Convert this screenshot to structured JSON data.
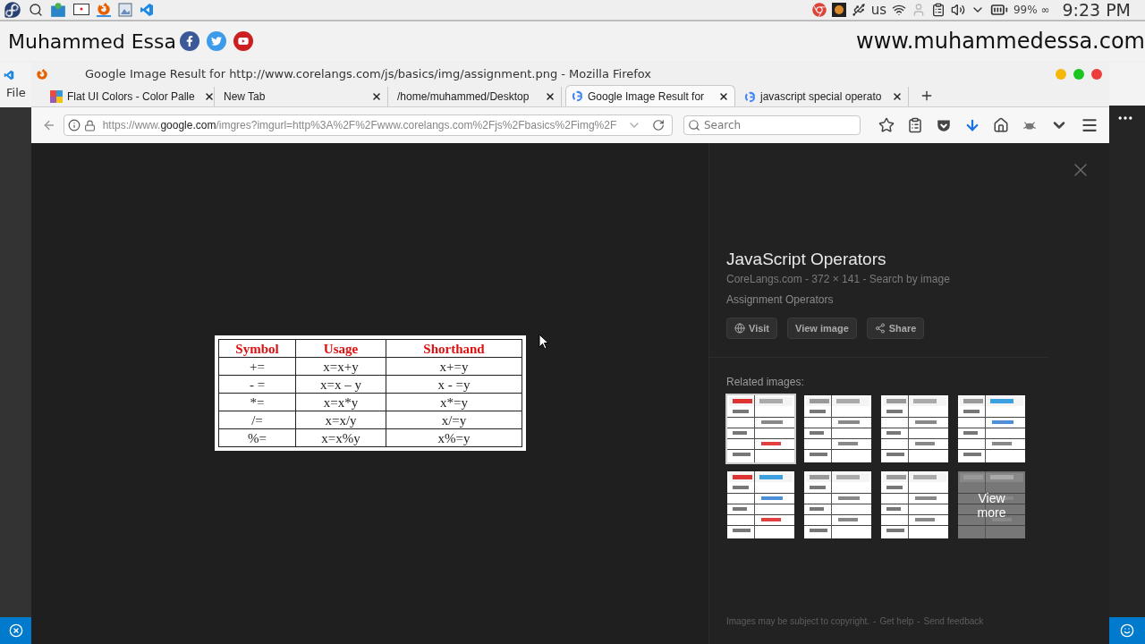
{
  "taskbar": {
    "keyboard_layout": "us",
    "battery": "99% ∞",
    "clock": "9:23 PM"
  },
  "banner": {
    "name": "Muhammed Essa",
    "website": "www.muhammedessa.com"
  },
  "editor": {
    "menu": "File"
  },
  "browser": {
    "title": "Google Image Result for http://www.corelangs.com/js/basics/img/assignment.png - Mozilla Firefox",
    "tabs": [
      {
        "label": "Flat UI Colors - Color Palle",
        "selected": false
      },
      {
        "label": "New Tab",
        "selected": false
      },
      {
        "label": "/home/muhammed/Desktop",
        "selected": false
      },
      {
        "label": "Google Image Result for",
        "selected": true
      },
      {
        "label": "javascript special operato",
        "selected": false
      }
    ],
    "url": {
      "scheme": "https://www.",
      "domain": "google.com",
      "path": "/imgres?imgurl=http%3A%2F%2Fwww.corelangs.com%2Fjs%2Fbasics%2Fimg%2F"
    },
    "search": {
      "placeholder": "Search"
    }
  },
  "image_table": {
    "columns": [
      "Symbol",
      "Usage",
      "Shorthand"
    ],
    "rows": [
      [
        "+=",
        "x=x+y",
        "x+=y"
      ],
      [
        "- =",
        "x=x – y",
        "x - =y"
      ],
      [
        "*=",
        "x=x*y",
        "x*=y"
      ],
      [
        "/=",
        "x=x/y",
        "x/=y"
      ],
      [
        "%=",
        "x=x%y",
        "x%=y"
      ]
    ]
  },
  "details": {
    "title": "JavaScript Operators",
    "meta": "CoreLangs.com - 372 × 141 - Search by image",
    "caption": "Assignment Operators",
    "buttons": [
      {
        "label": "Visit"
      },
      {
        "label": "View image"
      },
      {
        "label": "Share"
      }
    ],
    "related_label": "Related images:",
    "related": [
      {
        "kind": "picture",
        "selected": true
      },
      {
        "kind": "picture",
        "selected": false
      },
      {
        "kind": "picture",
        "selected": false
      },
      {
        "kind": "picture",
        "selected": false
      },
      {
        "kind": "picture",
        "selected": false
      },
      {
        "kind": "picture",
        "selected": false
      },
      {
        "kind": "picture",
        "selected": false
      },
      {
        "kind": "more",
        "selected": false,
        "label": "View more"
      }
    ]
  },
  "footer": [
    "Images may be subject to copyright.",
    "-",
    "Get help",
    "-",
    "Send feedback"
  ]
}
